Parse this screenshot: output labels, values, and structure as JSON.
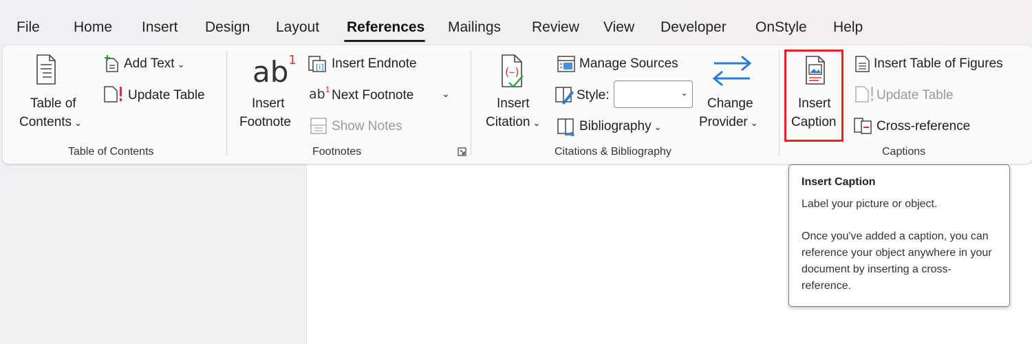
{
  "tabs": [
    {
      "label": "File"
    },
    {
      "label": "Home"
    },
    {
      "label": "Insert"
    },
    {
      "label": "Design"
    },
    {
      "label": "Layout"
    },
    {
      "label": "References"
    },
    {
      "label": "Mailings"
    },
    {
      "label": "Review"
    },
    {
      "label": "View"
    },
    {
      "label": "Developer"
    },
    {
      "label": "OnStyle"
    },
    {
      "label": "Help"
    }
  ],
  "active_tab": "References",
  "groups": {
    "toc": {
      "label": "Table of Contents",
      "toc_button": {
        "line1": "Table of",
        "line2": "Contents"
      },
      "add_text": "Add Text",
      "update_table": "Update Table"
    },
    "footnotes": {
      "label": "Footnotes",
      "insert_footnote": {
        "line1": "Insert",
        "line2": "Footnote"
      },
      "insert_endnote": "Insert Endnote",
      "next_footnote": "Next Footnote",
      "show_notes": "Show Notes"
    },
    "citations": {
      "label": "Citations & Bibliography",
      "insert_citation": {
        "line1": "Insert",
        "line2": "Citation"
      },
      "manage_sources": "Manage Sources",
      "style_label": "Style:",
      "style_value": "",
      "bibliography": "Bibliography",
      "change_provider": {
        "line1": "Change",
        "line2": "Provider"
      }
    },
    "captions": {
      "label": "Captions",
      "insert_caption": {
        "line1": "Insert",
        "line2": "Caption"
      },
      "insert_table_of_figures": "Insert Table of Figures",
      "update_table": "Update Table",
      "cross_reference": "Cross-reference"
    }
  },
  "tooltip": {
    "title": "Insert Caption",
    "line1": "Label your picture or object.",
    "body": "Once you've added a caption, you can reference your object anywhere in your document by inserting a cross-reference."
  },
  "colors": {
    "accent_blue": "#2b7cd3",
    "red": "#d13438",
    "highlight": "#e22424"
  }
}
